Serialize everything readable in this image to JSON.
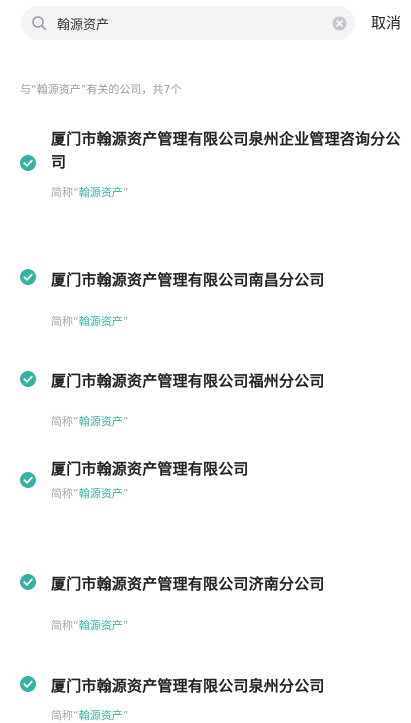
{
  "search": {
    "value": "翰源资产",
    "cancel_label": "取消"
  },
  "summary": "与“翰源资产”有关的公司，共7个",
  "results": [
    {
      "name": "厦门市翰源资产管理有限公司泉州企业管理咨询分公司",
      "alias_prefix": "简称“",
      "alias_highlight": "翰源资产",
      "alias_suffix": "”"
    },
    {
      "name": "厦门市翰源资产管理有限公司南昌分公司",
      "alias_prefix": "简称“",
      "alias_highlight": "翰源资产",
      "alias_suffix": "”"
    },
    {
      "name": "厦门市翰源资产管理有限公司福州分公司",
      "alias_prefix": "简称“",
      "alias_highlight": "翰源资产",
      "alias_suffix": "”"
    },
    {
      "name": "厦门市翰源资产管理有限公司",
      "alias_prefix": "简称“",
      "alias_highlight": "翰源资产",
      "alias_suffix": "”"
    },
    {
      "name": "厦门市翰源资产管理有限公司济南分公司",
      "alias_prefix": "简称“",
      "alias_highlight": "翰源资产",
      "alias_suffix": "”"
    },
    {
      "name": "厦门市翰源资产管理有限公司泉州分公司",
      "alias_prefix": "简称“",
      "alias_highlight": "翰源资产",
      "alias_suffix": "”"
    }
  ],
  "colors": {
    "accent": "#35b3a2"
  },
  "icons": {
    "search": "search-icon",
    "clear": "close-circle-icon",
    "check": "check-circle-icon"
  }
}
